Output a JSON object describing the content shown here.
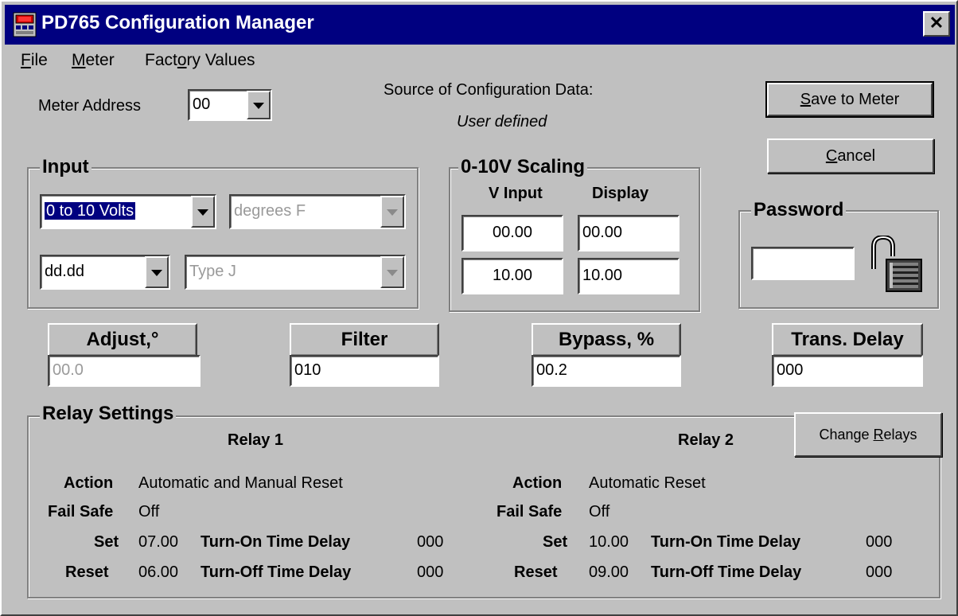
{
  "window": {
    "title": "PD765 Configuration Manager",
    "close_glyph": "✕"
  },
  "menu": [
    {
      "label": "File",
      "mnemonic": "F",
      "rest": "ile"
    },
    {
      "label": "Meter",
      "mnemonic": "M",
      "rest": "eter"
    },
    {
      "label": "Factory Values",
      "pre": "Fact",
      "mnemonic": "o",
      "rest": "ry Values"
    }
  ],
  "meter_address": {
    "label": "Meter Address",
    "value": "00"
  },
  "source": {
    "label": "Source of Configuration Data:",
    "value": "User defined"
  },
  "buttons": {
    "save": {
      "mnemonic": "S",
      "rest": "ave to Meter"
    },
    "cancel": {
      "mnemonic": "C",
      "rest": "ancel"
    },
    "change_relays": {
      "pre": "Change ",
      "mnemonic": "R",
      "rest": "elays"
    }
  },
  "input_group": {
    "label": "Input",
    "input_type": "0 to 10 Volts",
    "units": "degrees F",
    "decimal_format": "dd.dd",
    "thermocouple": "Type J"
  },
  "scaling": {
    "label": "0-10V Scaling",
    "v_input_header": "V Input",
    "display_header": "Display",
    "rows": [
      {
        "v_input": "00.00",
        "display": "00.00"
      },
      {
        "v_input": "10.00",
        "display": "10.00"
      }
    ]
  },
  "password": {
    "label": "Password",
    "value": "",
    "icon": "unlocked-padlock-icon"
  },
  "params": {
    "adjust": {
      "label": "Adjust,°",
      "value": "00.0"
    },
    "filter": {
      "label": "Filter",
      "value": "010"
    },
    "bypass": {
      "label": "Bypass, %",
      "value": "00.2"
    },
    "trans_delay": {
      "label": "Trans. Delay",
      "value": "000"
    }
  },
  "relays": {
    "label": "Relay Settings",
    "field_labels": {
      "action": "Action",
      "fail_safe": "Fail Safe",
      "set": "Set",
      "reset": "Reset",
      "turn_on": "Turn-On Time Delay",
      "turn_off": "Turn-Off Time Delay"
    },
    "relay1": {
      "title": "Relay 1",
      "action": "Automatic and Manual Reset",
      "fail_safe": "Off",
      "set": "07.00",
      "reset": "06.00",
      "turn_on_delay": "000",
      "turn_off_delay": "000"
    },
    "relay2": {
      "title": "Relay 2",
      "action": "Automatic Reset",
      "fail_safe": "Off",
      "set": "10.00",
      "reset": "09.00",
      "turn_on_delay": "000",
      "turn_off_delay": "000"
    }
  }
}
